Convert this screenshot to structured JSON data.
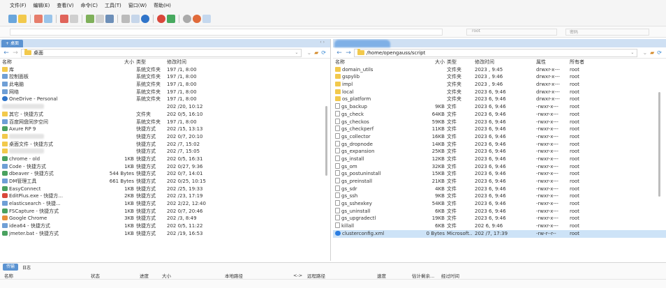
{
  "menu": [
    "文件(F)",
    "编辑(E)",
    "查看(V)",
    "命令(C)",
    "工具(T)",
    "窗口(W)",
    "帮助(H)"
  ],
  "addr": {
    "right_label1": "root",
    "right_label2": "密码"
  },
  "left": {
    "tab_label": "桌面",
    "path": "桌面",
    "columns": [
      "名称",
      "大小",
      "类型",
      "修改时间"
    ],
    "rows": [
      {
        "icon": "folder",
        "name": "库",
        "size": "",
        "type": "系统文件夹",
        "date": "197 /1, 8:00"
      },
      {
        "icon": "sys",
        "name": "控制面板",
        "size": "",
        "type": "系统文件夹",
        "date": "197 /1, 8:00"
      },
      {
        "icon": "sys",
        "name": "此电脑",
        "size": "",
        "type": "系统文件夹",
        "date": "197 /1, 8:00"
      },
      {
        "icon": "sys",
        "name": "网络",
        "size": "",
        "type": "系统文件夹",
        "date": "197 /1, 8:00"
      },
      {
        "icon": "cloud",
        "name": "OneDrive - Personal",
        "size": "",
        "type": "系统文件夹",
        "date": "197 /1, 8:00"
      },
      {
        "icon": "blur",
        "name": "",
        "size": "",
        "type": "",
        "date": "202 /20, 10:12"
      },
      {
        "icon": "folder",
        "name": "其它 - 快捷方式",
        "size": "",
        "type": "文件夹",
        "date": "202 0/5, 16:10"
      },
      {
        "icon": "sys",
        "name": "百度网盘同步空间",
        "size": "",
        "type": "系统文件夹",
        "date": "197 /1, 8:00"
      },
      {
        "icon": "app",
        "name": "Axure RP 9",
        "size": "",
        "type": "快捷方式",
        "date": "202 /15, 13:13"
      },
      {
        "icon": "folder",
        "name": "",
        "size": "",
        "type": "快捷方式",
        "date": "202 0/7, 20:10"
      },
      {
        "icon": "folder",
        "name": "桌面文件 - 快捷方式",
        "size": "",
        "type": "快捷方式",
        "date": "202 /7, 15:02"
      },
      {
        "icon": "folder",
        "name": "",
        "size": "",
        "type": "快捷方式",
        "date": "202 /7, 15:05"
      },
      {
        "icon": "app",
        "name": "chrome - old",
        "size": "1KB",
        "type": "快捷方式",
        "date": "202 0/5, 16:31"
      },
      {
        "icon": "sys",
        "name": "Code - 快捷方式",
        "size": "1KB",
        "type": "快捷方式",
        "date": "202 0/27, 9:36"
      },
      {
        "icon": "app",
        "name": "dbeaver - 快捷方式",
        "size": "544 Bytes",
        "type": "快捷方式",
        "date": "202 0/7, 14:01"
      },
      {
        "icon": "sys",
        "name": "DM管理工具",
        "size": "661 Bytes",
        "type": "快捷方式",
        "date": "202 0/25, 10:15"
      },
      {
        "icon": "app",
        "name": "EasyConnect",
        "size": "1KB",
        "type": "快捷方式",
        "date": "202 /25, 19:33"
      },
      {
        "icon": "red",
        "name": "EditPlus.exe - 快捷方...",
        "size": "2KB",
        "type": "快捷方式",
        "date": "202 /23, 17:19"
      },
      {
        "icon": "sys",
        "name": "elasticsearch - 快捷...",
        "size": "1KB",
        "type": "快捷方式",
        "date": "202 2/22, 12:40"
      },
      {
        "icon": "app",
        "name": "FSCapture - 快捷方式",
        "size": "1KB",
        "type": "快捷方式",
        "date": "202 0/7, 20:46"
      },
      {
        "icon": "orange",
        "name": "Google Chrome",
        "size": "3KB",
        "type": "快捷方式",
        "date": "202 /3, 8:49"
      },
      {
        "icon": "sys",
        "name": "idea64 - 快捷方式",
        "size": "1KB",
        "type": "快捷方式",
        "date": "202 0/5, 11:22"
      },
      {
        "icon": "app",
        "name": "jmeter.bat - 快捷方式",
        "size": "1KB",
        "type": "快捷方式",
        "date": "202 /19, 16:53"
      }
    ]
  },
  "right": {
    "path": "/home/opengauss/script",
    "columns": [
      "名称",
      "大小",
      "类型",
      "修改时间",
      "属性",
      "所有者"
    ],
    "rows": [
      {
        "icon": "folder",
        "name": "domain_utils",
        "size": "",
        "type": "文件夹",
        "date": "2023 , 9:45",
        "attr": "drwxr-x---",
        "owner": "root"
      },
      {
        "icon": "folder",
        "name": "gspylib",
        "size": "",
        "type": "文件夹",
        "date": "2023 , 9:46",
        "attr": "drwxr-x---",
        "owner": "root"
      },
      {
        "icon": "folder",
        "name": "impl",
        "size": "",
        "type": "文件夹",
        "date": "2023 , 9:46",
        "attr": "drwxr-x---",
        "owner": "root"
      },
      {
        "icon": "folder",
        "name": "local",
        "size": "",
        "type": "文件夹",
        "date": "2023 6, 9:46",
        "attr": "drwxr-x---",
        "owner": "root"
      },
      {
        "icon": "folder",
        "name": "os_platform",
        "size": "",
        "type": "文件夹",
        "date": "2023 6, 9:46",
        "attr": "drwxr-x---",
        "owner": "root"
      },
      {
        "icon": "file",
        "name": "gs_backup",
        "size": "9KB",
        "type": "文件",
        "date": "2023 6, 9:46",
        "attr": "-rwxr-x---",
        "owner": "root"
      },
      {
        "icon": "file",
        "name": "gs_check",
        "size": "64KB",
        "type": "文件",
        "date": "2023 6, 9:46",
        "attr": "-rwxr-x---",
        "owner": "root"
      },
      {
        "icon": "file",
        "name": "gs_checkos",
        "size": "59KB",
        "type": "文件",
        "date": "2023 6, 9:46",
        "attr": "-rwxr-x---",
        "owner": "root"
      },
      {
        "icon": "file",
        "name": "gs_checkperf",
        "size": "11KB",
        "type": "文件",
        "date": "2023 6, 9:46",
        "attr": "-rwxr-x---",
        "owner": "root"
      },
      {
        "icon": "file",
        "name": "gs_collector",
        "size": "16KB",
        "type": "文件",
        "date": "2023 6, 9:46",
        "attr": "-rwxr-x---",
        "owner": "root"
      },
      {
        "icon": "file",
        "name": "gs_dropnode",
        "size": "14KB",
        "type": "文件",
        "date": "2023 6, 9:46",
        "attr": "-rwxr-x---",
        "owner": "root"
      },
      {
        "icon": "file",
        "name": "gs_expansion",
        "size": "25KB",
        "type": "文件",
        "date": "2023 6, 9:46",
        "attr": "-rwxr-x---",
        "owner": "root"
      },
      {
        "icon": "file",
        "name": "gs_install",
        "size": "12KB",
        "type": "文件",
        "date": "2023 6, 9:46",
        "attr": "-rwxr-x---",
        "owner": "root"
      },
      {
        "icon": "file",
        "name": "gs_om",
        "size": "32KB",
        "type": "文件",
        "date": "2023 6, 9:46",
        "attr": "-rwxr-x---",
        "owner": "root"
      },
      {
        "icon": "file",
        "name": "gs_postuninstall",
        "size": "15KB",
        "type": "文件",
        "date": "2023 6, 9:46",
        "attr": "-rwxr-x---",
        "owner": "root"
      },
      {
        "icon": "file",
        "name": "gs_preinstall",
        "size": "21KB",
        "type": "文件",
        "date": "2023 6, 9:46",
        "attr": "-rwxr-x---",
        "owner": "root"
      },
      {
        "icon": "file",
        "name": "gs_sdr",
        "size": "4KB",
        "type": "文件",
        "date": "2023 6, 9:46",
        "attr": "-rwxr-x---",
        "owner": "root"
      },
      {
        "icon": "file",
        "name": "gs_ssh",
        "size": "9KB",
        "type": "文件",
        "date": "2023 6, 9:46",
        "attr": "-rwxr-x---",
        "owner": "root"
      },
      {
        "icon": "file",
        "name": "gs_sshexkey",
        "size": "54KB",
        "type": "文件",
        "date": "2023 6, 9:46",
        "attr": "-rwxr-x---",
        "owner": "root"
      },
      {
        "icon": "file",
        "name": "gs_uninstall",
        "size": "6KB",
        "type": "文件",
        "date": "2023 6, 9:46",
        "attr": "-rwxr-x---",
        "owner": "root"
      },
      {
        "icon": "file",
        "name": "gs_upgradectl",
        "size": "19KB",
        "type": "文件",
        "date": "2023 6, 9:46",
        "attr": "-rwxr-x---",
        "owner": "root"
      },
      {
        "icon": "file",
        "name": "killall",
        "size": "6KB",
        "type": "文件",
        "date": "202 6, 9:46",
        "attr": "-rwxr-x---",
        "owner": "root"
      },
      {
        "icon": "xml",
        "name": "clusterconfig.xml",
        "size": "0 Bytes",
        "type": "Microsoft...",
        "date": "202 /7, 17:39",
        "attr": "-rw-r--r--",
        "owner": "root",
        "selected": true
      }
    ]
  },
  "queue": {
    "tabs": [
      "传输",
      "日志"
    ],
    "columns": [
      "名称",
      "状态",
      "进度",
      "大小",
      "本地路径",
      "<->",
      "远程路径",
      "速度",
      "估计剩余...",
      "经过时间"
    ]
  }
}
